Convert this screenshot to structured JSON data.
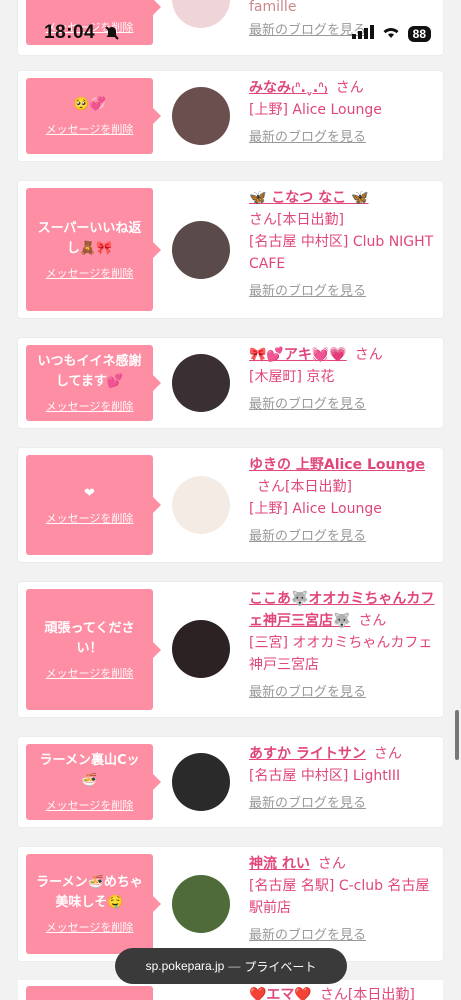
{
  "status_bar": {
    "time": "18:04",
    "battery": "88"
  },
  "top_partial": {
    "shop_fragment": "famille",
    "blog_label": "最新のブログを見る",
    "delete_label": "メッセージを削除"
  },
  "cards": [
    {
      "message": "🥺💞",
      "delete_label": "メッセージを削除",
      "name": "みなみ₍ᐢ.ˬ.ᐢ₎",
      "san": "さん",
      "status": "",
      "shop": "[上野] Alice Lounge",
      "blog_label": "最新のブログを見る",
      "avatar_color": "#6b4f4f"
    },
    {
      "message": "スーパーいいね返し🧸🎀",
      "delete_label": "メッセージを削除",
      "name": "🦋 こなつ なこ 🦋",
      "san": "さん",
      "status": "[本日出勤]",
      "shop": "[名古屋 中村区] Club NIGHT CAFE",
      "blog_label": "最新のブログを見る",
      "avatar_color": "#5a4a4a"
    },
    {
      "message": "いつもイイネ感謝してます💕",
      "delete_label": "メッセージを削除",
      "name": "🎀💕アキ💓💗",
      "san": "さん",
      "status": "",
      "shop": "[木屋町] 京花",
      "blog_label": "最新のブログを見る",
      "avatar_color": "#3a3034"
    },
    {
      "message": "❤",
      "delete_label": "メッセージを削除",
      "name": "ゆきの 上野Alice Lounge",
      "san": "さん",
      "status": "[本日出勤]",
      "shop": "[上野] Alice Lounge",
      "blog_label": "最新のブログを見る",
      "avatar_color": "#f4ece4"
    },
    {
      "message": "頑張ってください！",
      "delete_label": "メッセージを削除",
      "name": "ここあ🐺オオカミちゃんカフェ神戸三宮店🐺",
      "san": "さん",
      "status": "",
      "shop": "[三宮] オオカミちゃんカフェ神戸三宮店",
      "blog_label": "最新のブログを見る",
      "avatar_color": "#2c2224"
    },
    {
      "message": "ラーメン裏山Cッ🍜",
      "delete_label": "メッセージを削除",
      "name": "あすか ライトサン",
      "san": "さん",
      "status": "",
      "shop": "[名古屋 中村区] LightIII",
      "blog_label": "最新のブログを見る",
      "avatar_color": "#2a2a2a"
    },
    {
      "message": "ラーメン🍜めちゃ美味しそ🤤",
      "delete_label": "メッセージを削除",
      "name": "神流 れい",
      "san": "さん",
      "status": "",
      "shop": "[名古屋 名駅] C-club 名古屋駅前店",
      "blog_label": "最新のブログを見る",
      "avatar_color": "#4f6b3a"
    }
  ],
  "bottom_partial": {
    "name": "❤️エマ❤️",
    "san": "さん",
    "status": "[本日出勤]"
  },
  "url_bar": {
    "domain": "sp.pokepara.jp",
    "separator": "—",
    "mode": "プライベート"
  }
}
